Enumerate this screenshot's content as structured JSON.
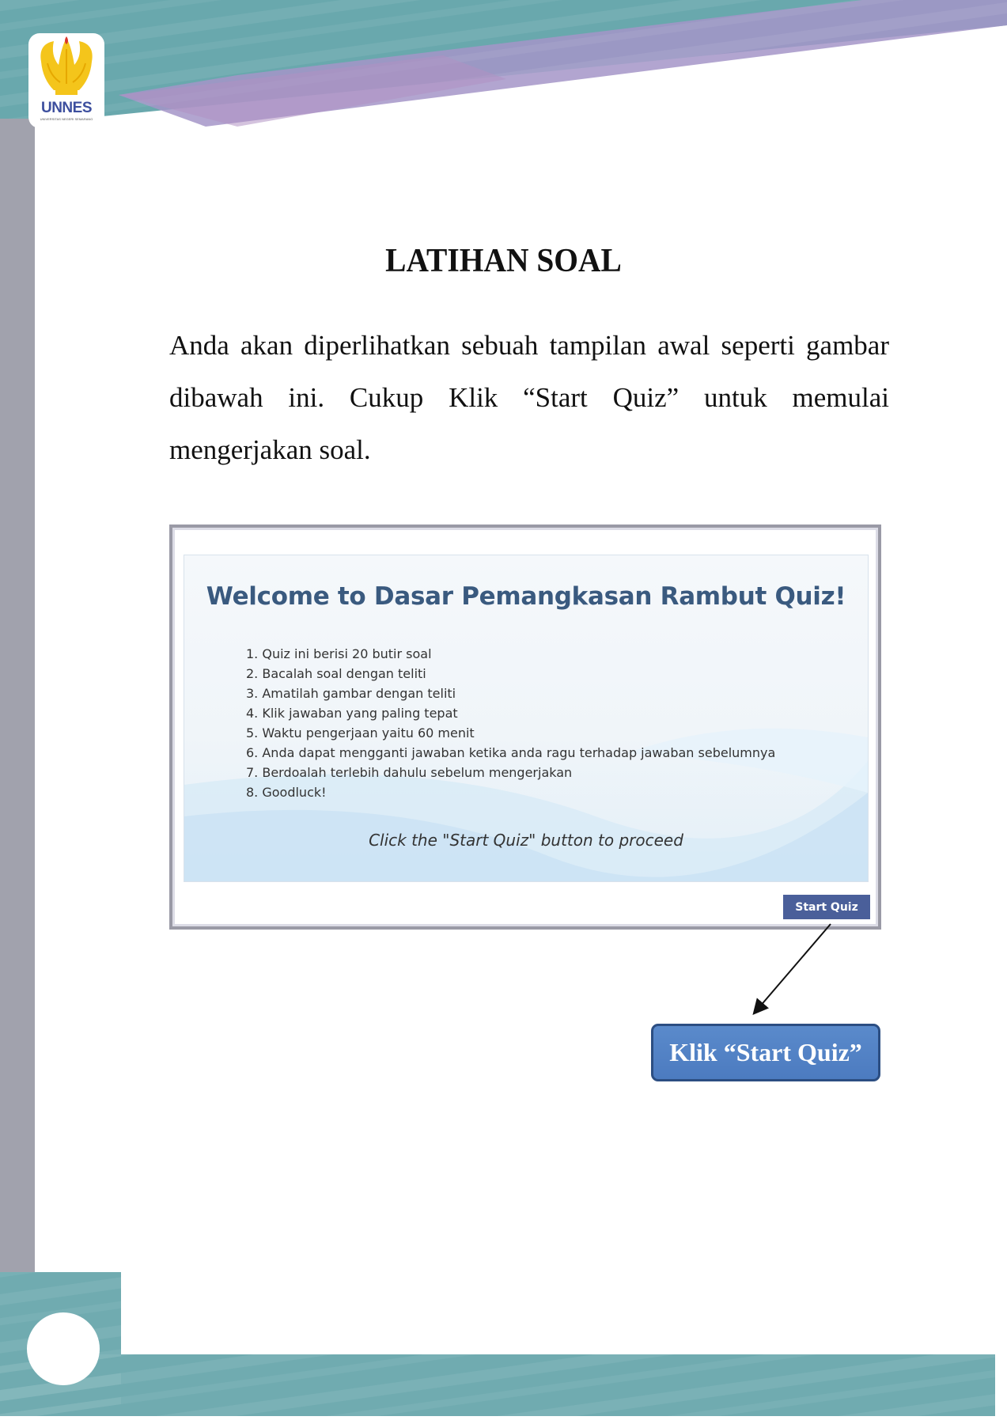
{
  "logo": {
    "name": "UNNES",
    "subtitle": "UNIVERSITAS NEGERI SEMARANG"
  },
  "page": {
    "title": "LATIHAN SOAL",
    "intro": "Anda akan diperlihatkan sebuah tampilan awal seperti gambar dibawah ini. Cukup Klik “Start Quiz” untuk memulai mengerjakan soal."
  },
  "quiz_screenshot": {
    "title": "Welcome to Dasar Pemangkasan Rambut Quiz!",
    "rules": [
      "1. Quiz ini berisi 20 butir soal",
      "2. Bacalah soal dengan teliti",
      "3. Amatilah gambar dengan teliti",
      "4. Klik jawaban yang paling tepat",
      "5. Waktu pengerjaan yaitu 60 menit",
      "6. Anda dapat mengganti jawaban ketika anda ragu terhadap jawaban sebelumnya",
      "7. Berdoalah terlebih dahulu sebelum mengerjakan",
      "8. Goodluck!"
    ],
    "proceed_text": "Click the \"Start Quiz\" button to proceed",
    "start_button": "Start Quiz"
  },
  "callout": {
    "label": "Klik “Start Quiz”"
  },
  "colors": {
    "teal": "#6aa8ae",
    "lavender": "#9d91c4",
    "gray_stripe": "#9e9faa",
    "button": "#4a5f9a",
    "callout": "#4f7fc3"
  }
}
